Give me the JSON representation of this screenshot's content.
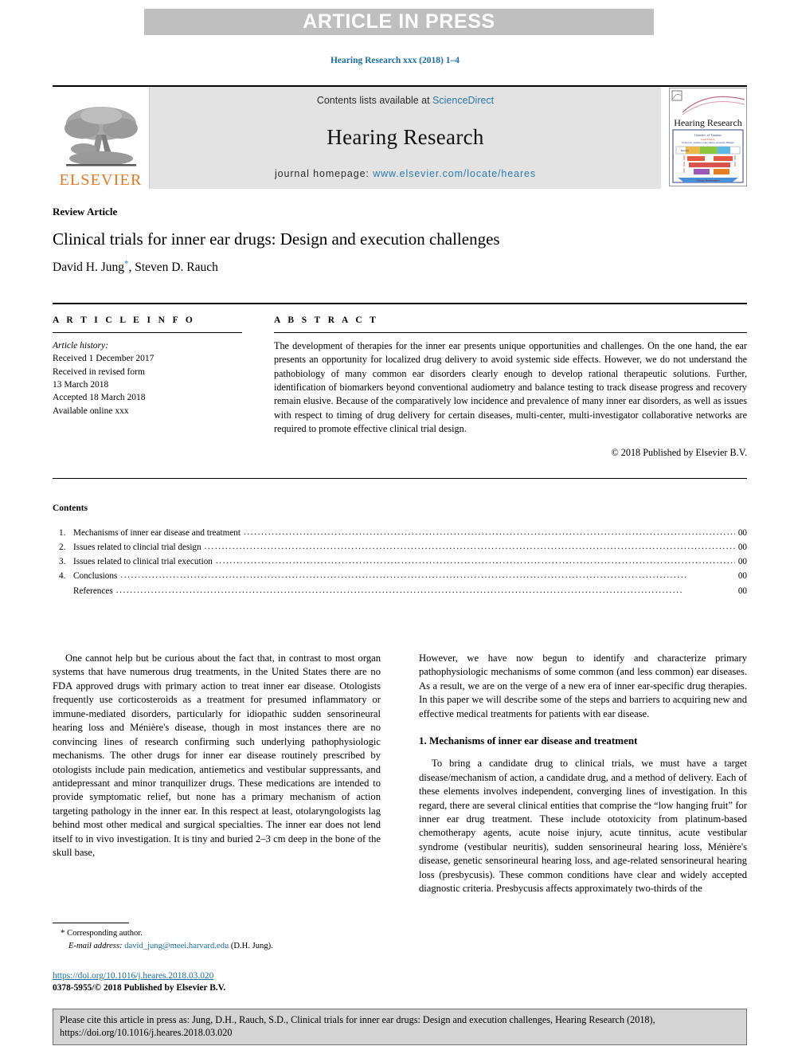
{
  "banner": {
    "text": "ARTICLE IN PRESS"
  },
  "running_head": {
    "text": "Hearing Research xxx (2018) 1–4",
    "color": "#1b6ca8"
  },
  "masthead": {
    "publisher_logo_text": "ELSEVIER",
    "publisher_logo_color": "#e87722",
    "contents_prefix": "Contents lists available at ",
    "contents_link": "ScienceDirect",
    "journal_name": "Hearing Research",
    "homepage_prefix": "journal homepage: ",
    "homepage_url": "www.elsevier.com/locate/heares",
    "link_color": "#2a7ab0",
    "cover": {
      "title": "Hearing Research",
      "subtitle_1": "Genetics of Tinnitus",
      "subtitle_2": "Guest Editors:",
      "subtitle_3": "Frank Lin, Jennifer Lentz, Marie-Adrienne Hinnant-Fruit, Ian Ray",
      "label_baseline": "Baseline",
      "label_outcome": "Outcome",
      "label_inner_workings": "Inner Workings",
      "band_center": "GENETICS",
      "box_mid": "PHENO",
      "box_mid_2": "GENOME",
      "box_bottom": "GENOTYPE",
      "footer": "Tinnitus Manifestation"
    }
  },
  "article": {
    "type": "Review Article",
    "title": "Clinical trials for inner ear drugs: Design and execution challenges",
    "authors_pre": "David H. Jung",
    "author_star": "*",
    "authors_post": ", Steven D. Rauch"
  },
  "article_info": {
    "label": "A R T I C L E  I N F O",
    "history_title": "Article history:",
    "history_lines": [
      "Received 1 December 2017",
      "Received in revised form",
      "13 March 2018",
      "Accepted 18 March 2018",
      "Available online xxx"
    ]
  },
  "abstract": {
    "label": "A B S T R A C T",
    "text": "The development of therapies for the inner ear presents unique opportunities and challenges. On the one hand, the ear presents an opportunity for localized drug delivery to avoid systemic side effects. However, we do not understand the pathobiology of many common ear disorders clearly enough to develop rational therapeutic solutions. Further, identification of biomarkers beyond conventional audiometry and balance testing to track disease progress and recovery remain elusive. Because of the comparatively low incidence and prevalence of many inner ear disorders, as well as issues with respect to timing of drug delivery for certain diseases, multi-center, multi-investigator collaborative networks are required to promote effective clinical trial design.",
    "copyright": "© 2018 Published by Elsevier B.V."
  },
  "contents": {
    "heading": "Contents",
    "items": [
      {
        "num": "1.",
        "label": "Mechanisms of inner ear disease and treatment",
        "page": "00"
      },
      {
        "num": "2.",
        "label": "Issues related to clincial trial design",
        "page": "00"
      },
      {
        "num": "3.",
        "label": "Issues related to clinical trial execution",
        "page": "00"
      },
      {
        "num": "4.",
        "label": "Conclusions",
        "page": "00"
      },
      {
        "num": "",
        "label": "References",
        "page": "00"
      }
    ]
  },
  "body": {
    "left_para_1": "One cannot help but be curious about the fact that, in contrast to most organ systems that have numerous drug treatments, in the United States there are no FDA approved drugs with primary action to treat inner ear disease. Otologists frequently use corticosteroids as a treatment for presumed inflammatory or immune-mediated disorders, particularly for idiopathic sudden sensorineural hearing loss and Ménière's disease, though in most instances there are no convincing lines of research confirming such underlying pathophysiologic mechanisms. The other drugs for inner ear disease routinely prescribed by otologists include pain medication, antiemetics and vestibular suppressants, and antidepressant and minor tranquilizer drugs. These medications are intended to provide symptomatic relief, but none has a primary mechanism of action targeting pathology in the inner ear. In this respect at least, otolaryngologists lag behind most other medical and surgical specialties. The inner ear does not lend itself to in vivo investigation. It is tiny and buried 2–3 cm deep in the bone of the skull base,",
    "right_para_1": "However, we have now begun to identify and characterize primary pathophysiologic mechanisms of some common (and less common) ear diseases. As a result, we are on the verge of a new era of inner ear-specific drug therapies. In this paper we will describe some of the steps and barriers to acquiring new and effective medical treatments for patients with ear disease.",
    "section_1_heading": "1. Mechanisms of inner ear disease and treatment",
    "right_para_2": "To bring a candidate drug to clinical trials, we must have a target disease/mechanism of action, a candidate drug, and a method of delivery. Each of these elements involves independent, converging lines of investigation. In this regard, there are several clinical entities that comprise the “low hanging fruit” for inner ear drug treatment. These include ototoxicity from platinum-based chemotherapy agents, acute noise injury, acute tinnitus, acute vestibular syndrome (vestibular neuritis), sudden sensorineural hearing loss, Ménière's disease, genetic sensorineural hearing loss, and age-related sensorineural hearing loss (presbycusis). These common conditions have clear and widely accepted diagnostic criteria. Presbycusis affects approximately two-thirds of the"
  },
  "footnote": {
    "star": "*",
    "corresponding": "Corresponding author.",
    "email_label": "E-mail address:",
    "email": "david_jung@meei.harvard.edu",
    "email_suffix": "(D.H. Jung).",
    "doi_url": "https://doi.org/10.1016/j.heares.2018.03.020",
    "issn_line": "0378-5955/© 2018 Published by Elsevier B.V."
  },
  "cite_box": {
    "text": "Please cite this article in press as: Jung, D.H., Rauch, S.D., Clinical trials for inner ear drugs: Design and execution challenges, Hearing Research (2018), https://doi.org/10.1016/j.heares.2018.03.020"
  }
}
